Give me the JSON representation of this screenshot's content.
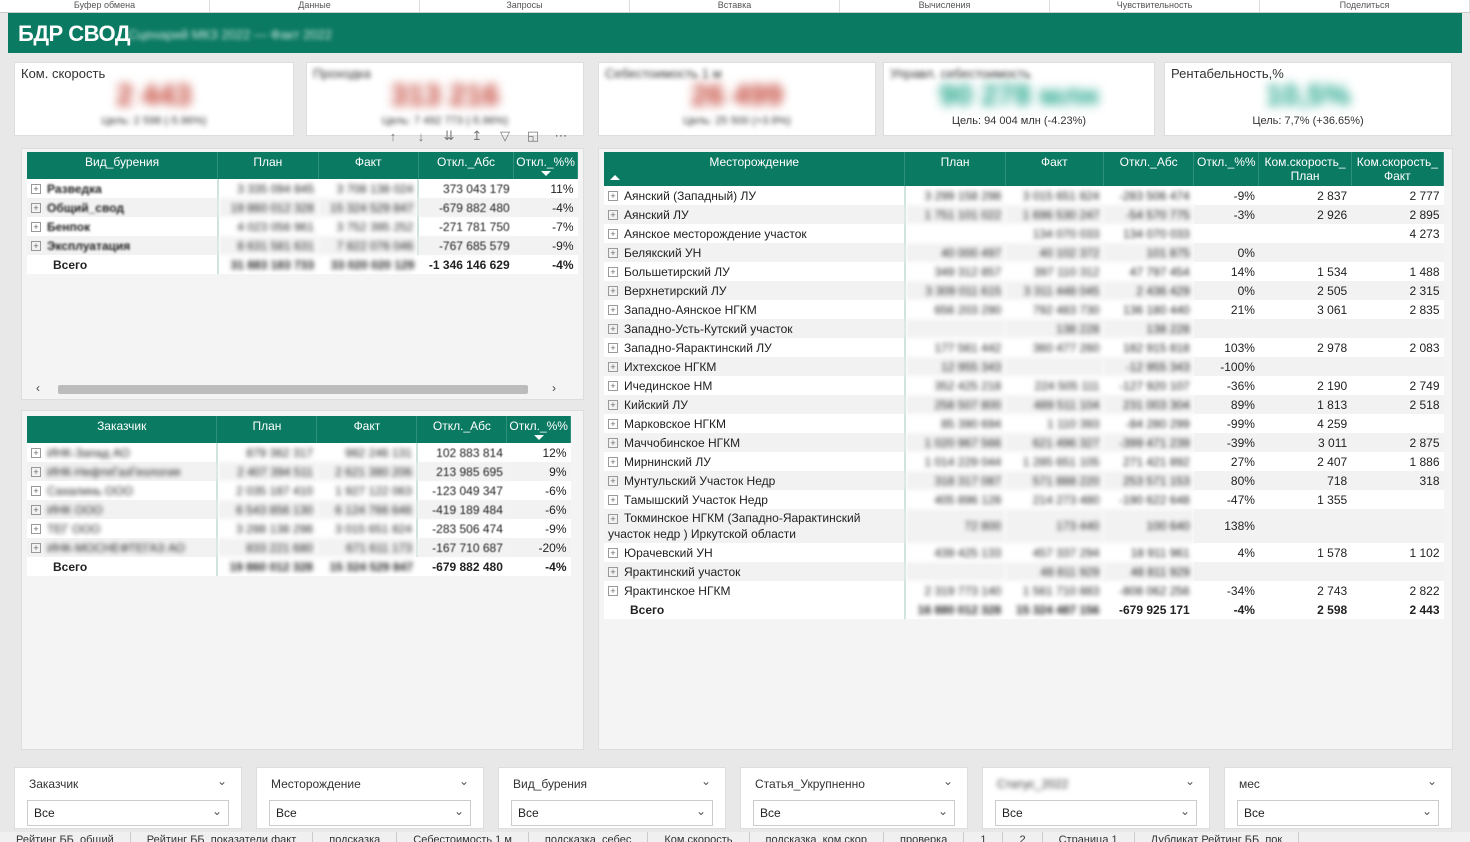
{
  "ribbon": [
    "Буфер обмена",
    "Данные",
    "Запросы",
    "Вставка",
    "Вычисления",
    "Чувствительность",
    "Поделиться"
  ],
  "header": {
    "title": "БДР СВОД",
    "subtitle": "Сценарий МКЗ 2022 — Факт 2022"
  },
  "kpis": [
    {
      "label": "Ком. скорость",
      "value": "2 443",
      "target": "Цель: 2 598 (-5.96%)",
      "color": "red"
    },
    {
      "label": "Проходка",
      "value": "313 216",
      "target": "Цель: 7 492 773 (-5.96%)",
      "color": "red"
    },
    {
      "label": "Себестоимость 1 м",
      "value": "26 499",
      "target": "Цель: 25 500 (+3.9%)",
      "color": "red"
    },
    {
      "label": "Управл. себестоимость",
      "value": "90 278 млн",
      "target": "Цель: 94 004 млн (-4.23%)",
      "color": "green"
    },
    {
      "label": "Рентабельность,%",
      "value": "10,5%",
      "target": "Цель: 7,7% (+36.65%)",
      "color": "green"
    }
  ],
  "visual_toolbar": {
    "icons": [
      "arrow-up-icon",
      "arrow-down-icon",
      "expand-icon",
      "drill-icon",
      "filter-icon",
      "focus-icon",
      "more-icon"
    ]
  },
  "table1": {
    "headers": [
      "Вид_бурения",
      "План",
      "Факт",
      "Откл._Абс",
      "Откл._%%"
    ],
    "rows": [
      {
        "name": "Разведка",
        "plan": "3 335 094 845",
        "fact": "3 708 138 024",
        "abs": "373 043 179",
        "pct": "11%"
      },
      {
        "name": "Общий_свод",
        "plan": "19 860 012 328",
        "fact": "15 324 529 847",
        "abs": "-679 882 480",
        "pct": "-4%"
      },
      {
        "name": "Бенпок",
        "plan": "4 023 056 961",
        "fact": "3 752 395 252",
        "abs": "-271 781 750",
        "pct": "-7%"
      },
      {
        "name": "Эксплуатация",
        "plan": "8 631 581 631",
        "fact": "7 822 076 046",
        "abs": "-767 685 579",
        "pct": "-9%"
      }
    ],
    "total": {
      "name": "Всего",
      "plan": "31 883 183 733",
      "fact": "33 020 020 129",
      "abs": "-1 346 146 629",
      "pct": "-4%"
    }
  },
  "table2": {
    "headers": [
      "Заказчик",
      "План",
      "Факт",
      "Откл._Абс",
      "Откл._%%"
    ],
    "rows": [
      {
        "name": "ИНК-Запад АО",
        "plan": "879 362 317",
        "fact": "982 246 131",
        "abs": "102 883 814",
        "pct": "12%"
      },
      {
        "name": "ИНК-НефтеГазГеология",
        "plan": "2 407 394 511",
        "fact": "2 621 380 206",
        "abs": "213 985 695",
        "pct": "9%"
      },
      {
        "name": "Сахалинь ООО",
        "plan": "2 035 187 410",
        "fact": "1 927 122 063",
        "abs": "-123 049 347",
        "pct": "-6%"
      },
      {
        "name": "ИНК ООО",
        "plan": "6 543 856 130",
        "fact": "6 124 766 646",
        "abs": "-419 189 484",
        "pct": "-6%"
      },
      {
        "name": "ТЕГ ООО",
        "plan": "3 288 138 298",
        "fact": "3 015 651 824",
        "abs": "-283 506 474",
        "pct": "-9%"
      },
      {
        "name": "ИНК-МОСНЕФТЕГАЗ АО",
        "plan": "833 221 680",
        "fact": "671 611 173",
        "abs": "-167 710 687",
        "pct": "-20%"
      }
    ],
    "total": {
      "name": "Всего",
      "plan": "19 860 012 328",
      "fact": "15 324 529 847",
      "abs": "-679 882 480",
      "pct": "-4%"
    }
  },
  "table3": {
    "headers": [
      "Месторождение",
      "План",
      "Факт",
      "Откл._Абс",
      "Откл._%%",
      "Ком.скорость_ План",
      "Ком.скорость_ Факт"
    ],
    "rows": [
      {
        "name": "Аянский (Западный) ЛУ",
        "plan": "3 299 158 298",
        "fact": "3 015 651 824",
        "abs": "-283 506 474",
        "pct": "-9%",
        "ksp": "2 837",
        "ksf": "2 777"
      },
      {
        "name": "Аянский ЛУ",
        "plan": "1 751 101 022",
        "fact": "1 696 530 247",
        "abs": "-54 570 775",
        "pct": "-3%",
        "ksp": "2 926",
        "ksf": "2 895"
      },
      {
        "name": "Аянское месторождение участок",
        "plan": "",
        "fact": "134 070 033",
        "abs": "134 070 033",
        "pct": "",
        "ksp": "",
        "ksf": "4 273"
      },
      {
        "name": "Белякский УН",
        "plan": "40 000 497",
        "fact": "40 102 372",
        "abs": "101 875",
        "pct": "0%",
        "ksp": "",
        "ksf": ""
      },
      {
        "name": "Большетирский ЛУ",
        "plan": "349 312 857",
        "fact": "397 110 312",
        "abs": "47 797 454",
        "pct": "14%",
        "ksp": "1 534",
        "ksf": "1 488"
      },
      {
        "name": "Верхнетирский ЛУ",
        "plan": "3 309 011 615",
        "fact": "3 311 448 045",
        "abs": "2 436 429",
        "pct": "0%",
        "ksp": "2 505",
        "ksf": "2 315"
      },
      {
        "name": "Западно-Аянское НГКМ",
        "plan": "656 203 290",
        "fact": "792 483 730",
        "abs": "136 180 440",
        "pct": "21%",
        "ksp": "3 061",
        "ksf": "2 835"
      },
      {
        "name": "Западно-Усть-Кутский участок",
        "plan": "",
        "fact": "138 228",
        "abs": "138 228",
        "pct": "",
        "ksp": "",
        "ksf": ""
      },
      {
        "name": "Западно-Яарактинский ЛУ",
        "plan": "177 561 442",
        "fact": "360 477 260",
        "abs": "182 915 818",
        "pct": "103%",
        "ksp": "2 978",
        "ksf": "2 083"
      },
      {
        "name": "Ихтехское НГКМ",
        "plan": "12 955 343",
        "fact": "",
        "abs": "-12 955 343",
        "pct": "-100%",
        "ksp": "",
        "ksf": ""
      },
      {
        "name": "Ичединское НМ",
        "plan": "352 425 218",
        "fact": "224 505 111",
        "abs": "-127 920 107",
        "pct": "-36%",
        "ksp": "2 190",
        "ksf": "2 749"
      },
      {
        "name": "Кийский ЛУ",
        "plan": "258 507 800",
        "fact": "489 511 104",
        "abs": "231 003 304",
        "pct": "89%",
        "ksp": "1 813",
        "ksf": "2 518"
      },
      {
        "name": "Марковское НГКМ",
        "plan": "85 390 694",
        "fact": "1 110 393",
        "abs": "-84 280 299",
        "pct": "-99%",
        "ksp": "4 259",
        "ksf": ""
      },
      {
        "name": "Маччобинское НГКМ",
        "plan": "1 020 967 566",
        "fact": "621 496 327",
        "abs": "-399 471 239",
        "pct": "-39%",
        "ksp": "3 011",
        "ksf": "2 875"
      },
      {
        "name": "Мирнинский ЛУ",
        "plan": "1 014 229 044",
        "fact": "1 285 651 105",
        "abs": "271 421 892",
        "pct": "27%",
        "ksp": "2 407",
        "ksf": "1 886"
      },
      {
        "name": "Мунтульский Участок Недр",
        "plan": "318 317 087",
        "fact": "571 888 220",
        "abs": "253 571 153",
        "pct": "80%",
        "ksp": "718",
        "ksf": "318"
      },
      {
        "name": "Тамышский Участок Недр",
        "plan": "405 896 128",
        "fact": "214 273 480",
        "abs": "-190 622 648",
        "pct": "-47%",
        "ksp": "1 355",
        "ksf": ""
      },
      {
        "name": "Токминское НГКМ (Западно-Яарактинский участок недр ) Иркутской области",
        "plan": "72 800",
        "fact": "173 440",
        "abs": "100 640",
        "pct": "138%",
        "ksp": "",
        "ksf": ""
      },
      {
        "name": "Юрачевский УН",
        "plan": "439 425 133",
        "fact": "457 337 294",
        "abs": "18 911 961",
        "pct": "4%",
        "ksp": "1 578",
        "ksf": "1 102"
      },
      {
        "name": "Ярактинский участок",
        "plan": "",
        "fact": "48 811 929",
        "abs": "48 811 929",
        "pct": "",
        "ksp": "",
        "ksf": ""
      },
      {
        "name": "Ярактинское НГКМ",
        "plan": "2 319 773 140",
        "fact": "1 561 710 883",
        "abs": "-808 062 256",
        "pct": "-34%",
        "ksp": "2 743",
        "ksf": "2 822"
      }
    ],
    "total": {
      "name": "Всего",
      "plan": "16 880 012 328",
      "fact": "15 324 487 156",
      "abs": "-679 925 171",
      "pct": "-4%",
      "ksp": "2 598",
      "ksf": "2 443"
    }
  },
  "slicers": [
    {
      "label": "Заказчик",
      "value": "Все"
    },
    {
      "label": "Месторождение",
      "value": "Все"
    },
    {
      "label": "Вид_бурения",
      "value": "Все"
    },
    {
      "label": "Статья_Укрупненно",
      "value": "Все"
    },
    {
      "label": "Статус_2022",
      "value": "Все"
    },
    {
      "label": "мес",
      "value": "Все"
    }
  ],
  "pages": [
    "Рейтинг ББ_общий",
    "Рейтинг ББ_показатели факт",
    "подсказка",
    "Себестоимость 1 м",
    "подсказка_себес",
    "Ком.скорость",
    "подсказка_ком.скор",
    "проверка",
    "1",
    "2",
    "Страница 1",
    "Дубликат Рейтинг ББ_пок"
  ]
}
